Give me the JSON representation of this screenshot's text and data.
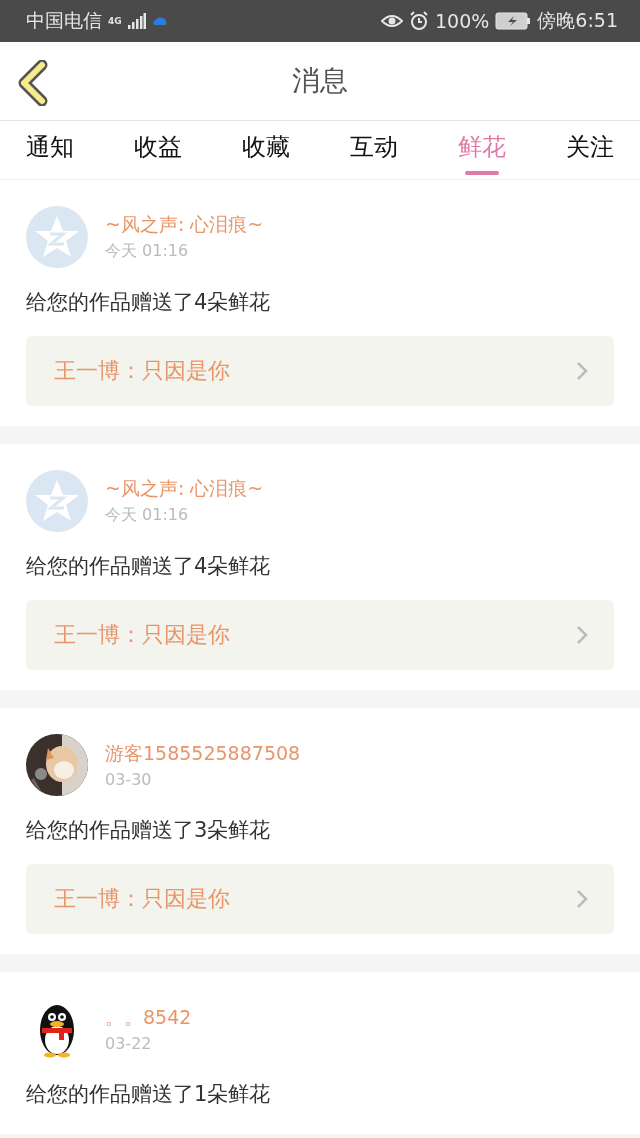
{
  "status_bar": {
    "carrier": "中国电信",
    "network": "4G",
    "battery": "100%",
    "time": "傍晚6:51"
  },
  "header": {
    "title": "消息"
  },
  "tabs": [
    {
      "label": "通知",
      "selected": false
    },
    {
      "label": "收益",
      "selected": false
    },
    {
      "label": "收藏",
      "selected": false
    },
    {
      "label": "互动",
      "selected": false
    },
    {
      "label": "鲜花",
      "selected": true
    },
    {
      "label": "关注",
      "selected": false
    }
  ],
  "messages": [
    {
      "avatar": {
        "kind": "qzone"
      },
      "name": "~风之声: 心泪痕~",
      "time": "今天 01:16",
      "text": "给您的作品赠送了4朵鲜花",
      "work": "王一博：只因是你"
    },
    {
      "avatar": {
        "kind": "qzone"
      },
      "name": "~风之声: 心泪痕~",
      "time": "今天 01:16",
      "text": "给您的作品赠送了4朵鲜花",
      "work": "王一博：只因是你"
    },
    {
      "name": "游客1585525887508",
      "time": "03-30",
      "text": "给您的作品赠送了3朵鲜花",
      "work": "王一博：只因是你"
    },
    {
      "avatar": {
        "kind": "penguin"
      },
      "name": "。。8542",
      "time": "03-22",
      "text": "给您的作品赠送了1朵鲜花"
    }
  ]
}
